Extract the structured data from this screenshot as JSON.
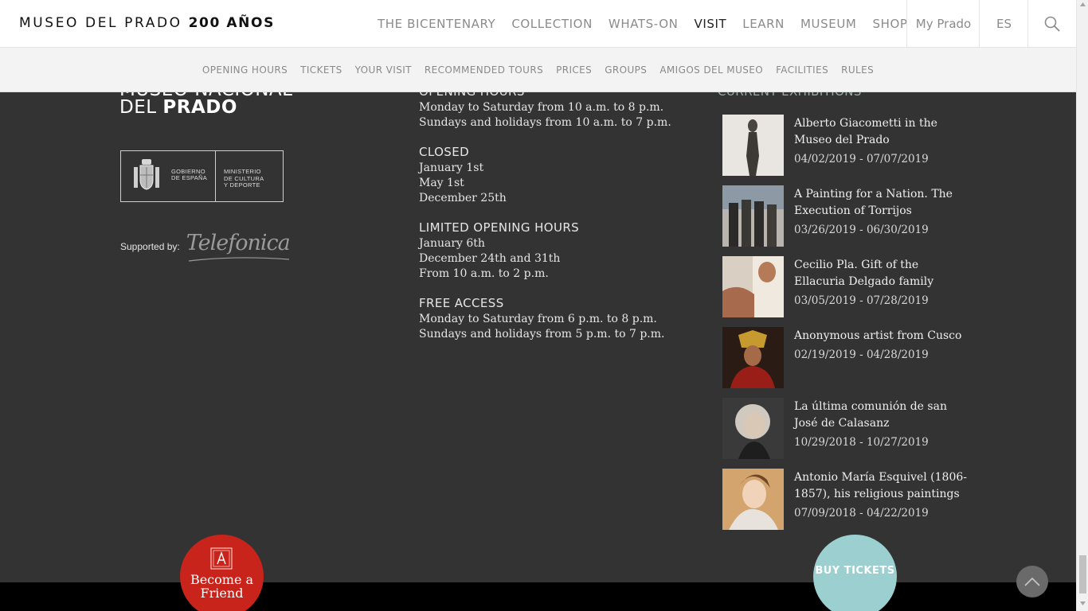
{
  "header": {
    "logo_text": "MUSEO DEL PRADO",
    "logo_bold": "200 AÑOS",
    "nav": [
      "THE BICENTENARY",
      "COLLECTION",
      "WHATS-ON",
      "VISIT",
      "LEARN",
      "MUSEUM",
      "SHOP"
    ],
    "active_nav": "VISIT",
    "my_prado": "My Prado",
    "lang": "ES",
    "search_icon": "search-icon"
  },
  "subnav": [
    "OPENING HOURS",
    "TICKETS",
    "YOUR VISIT",
    "RECOMMENDED TOURS",
    "PRICES",
    "GROUPS",
    "AMIGOS DEL MUSEO",
    "FACILITIES",
    "RULES"
  ],
  "footer": {
    "museum_logo": {
      "line1": "MUSEO NACIONAL",
      "line2_prefix": "DEL",
      "line2_bold": "PRADO"
    },
    "gov_logo": {
      "left": [
        "GOBIERNO",
        "DE ESPAÑA"
      ],
      "right": [
        "MINISTERIO",
        "DE CULTURA",
        "Y DEPORTE"
      ]
    },
    "supported_label": "Supported by:",
    "supporter": "Telefonica",
    "hours": [
      {
        "heading": "OPENING HOURS",
        "lines": [
          "Monday to Saturday from 10 a.m. to 8 p.m.",
          "Sundays and holidays from 10 a.m. to 7 p.m."
        ]
      },
      {
        "heading": "CLOSED",
        "lines": [
          "January 1st",
          "May 1st",
          "December 25th"
        ]
      },
      {
        "heading": "LIMITED OPENING HOURS",
        "lines": [
          "January 6th",
          "December 24th and 31th",
          "From 10 a.m. to 2 p.m."
        ]
      },
      {
        "heading": "FREE ACCESS",
        "lines": [
          "Monday to Saturday from 6 p.m. to 8 p.m.",
          "Sundays and holidays from 5 p.m. to 7 p.m."
        ]
      }
    ],
    "exhibitions_title": "CURRENT EXHIBITIONS",
    "exhibitions": [
      {
        "title": "Alberto Giacometti in the Museo del Prado",
        "dates": "04/02/2019 - 07/07/2019",
        "title_lines": 2
      },
      {
        "title": "A Painting for a Nation. The Execution of Torrijos",
        "dates": "03/26/2019 - 06/30/2019",
        "title_lines": 2
      },
      {
        "title": "Cecilio Pla. Gift of the Ellacuria Delgado family",
        "dates": "03/05/2019 - 07/28/2019",
        "title_lines": 2
      },
      {
        "title": "Anonymous artist from Cusco",
        "dates": "02/19/2019 - 04/28/2019",
        "title_lines": 1
      },
      {
        "title": "La última comunión de san José de Calasanz",
        "dates": "10/29/2018 - 10/27/2019",
        "title_lines": 2
      },
      {
        "title": "Antonio María Esquivel (1806-1857), his religious paintings",
        "dates": "07/09/2018 - 04/22/2019",
        "title_lines": 2
      }
    ],
    "become_friend": "Become a Friend",
    "buy_tickets": "BUY TICKETS"
  },
  "colors": {
    "footer_bg": "#333333",
    "friend_red": "#c8241b",
    "tickets_teal": "#9ccfd0"
  }
}
